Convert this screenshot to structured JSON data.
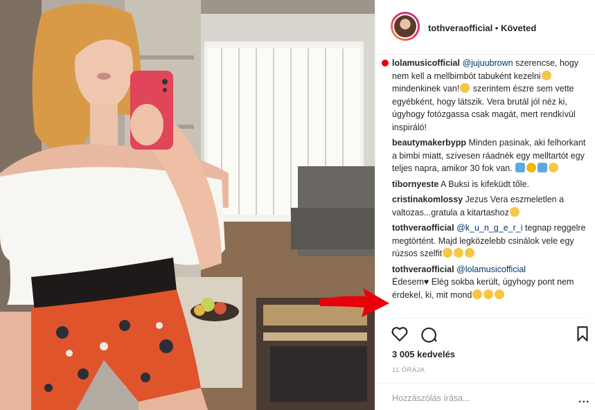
{
  "header": {
    "username": "tothveraofficial",
    "separator": " • ",
    "follow_status": "Követed"
  },
  "comments": [
    {
      "user": "lolamusicofficial",
      "mention": "@jujuubrown",
      "text": " szerencse, hogy nem kell a mellbimbót tabuként kezelni",
      "text2": " mindenkinek van!",
      "text3": " szerintem észre sem vette egyébként, hogy látszik. Vera brutál jól néz ki, úgyhogy fotózgassa csak magát, mert rendkívül inspiráló!"
    },
    {
      "user": "beautymakerbypp",
      "text": " Minden pasinak, aki felhorkant a bimbi miatt, szívesen ráadnék egy melltartót egy teljes napra, amikor 30 fok van. "
    },
    {
      "user": "tibornyeste",
      "text": " A Buksi is kifeküdt tőle."
    },
    {
      "user": "cristinakomlossy",
      "text": " Jezus Vera eszmeletlen a valtozas...gratula a kitartashoz"
    },
    {
      "user": "tothveraofficial",
      "mention": "@k_u_n_g_e_r_i",
      "text": " tegnap reggelre megtörtént. Majd legközelebb csinálok vele egy rúzsos szelfit"
    },
    {
      "user": "tothveraofficial",
      "mention": "@lolamusicofficial",
      "text": "Édesem♥ Elég sokba került, úgyhogy pont nem érdekel, ki, mit mond"
    }
  ],
  "actions": {
    "like_icon": "heart-icon",
    "comment_icon": "comment-bubble-icon",
    "save_icon": "bookmark-icon"
  },
  "likes": "3 005 kedvelés",
  "timestamp": "11 ÓRÁJA",
  "add_comment": {
    "placeholder": "Hozzászólás írása...",
    "more": "..."
  },
  "colors": {
    "text": "#262626",
    "mention": "#003569",
    "muted": "#999999",
    "annotation_red": "#e8000b"
  }
}
